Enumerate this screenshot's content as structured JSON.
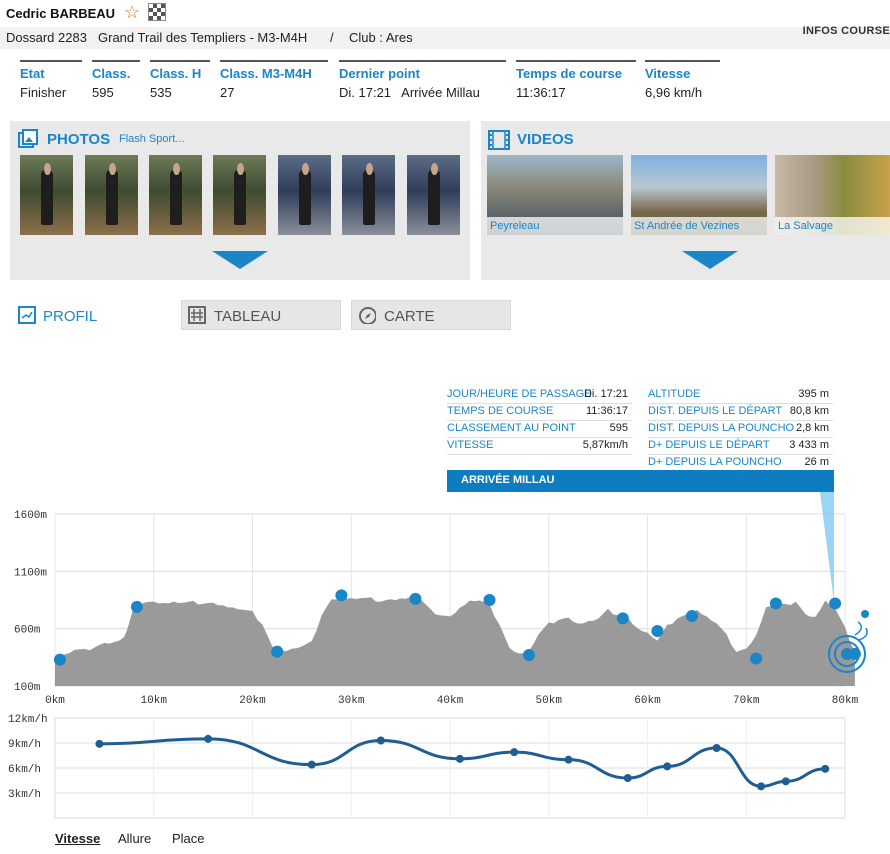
{
  "header": {
    "name": "Cedric BARBEAU",
    "dossard": "Dossard 2283",
    "race": "Grand Trail des Templiers - M3-M4H",
    "separator": "/",
    "club": "Club : Ares",
    "infos_link": "INFOS COURSE"
  },
  "stats": [
    {
      "label": "Etat",
      "value": "Finisher"
    },
    {
      "label": "Class.",
      "value": "595"
    },
    {
      "label": "Class. H",
      "value": "535"
    },
    {
      "label": "Class. M3-M4H",
      "value": "27"
    },
    {
      "label": "Dernier point",
      "value": "Di. 17:21   Arrivée Millau"
    },
    {
      "label": "Temps de course",
      "value": "11:36:17"
    },
    {
      "label": "Vitesse",
      "value": "6,96 km/h"
    }
  ],
  "photos": {
    "title": "PHOTOS",
    "provider": "Flash Sport..."
  },
  "videos": {
    "title": "VIDEOS",
    "items": [
      "Peyreleau",
      "St Andrée de Vezines",
      "La Salvage"
    ]
  },
  "tabs": {
    "profil": "PROFIL",
    "tableau": "TABLEAU",
    "carte": "CARTE"
  },
  "info_left": [
    {
      "k": "JOUR/HEURE DE PASSAGE",
      "v": "Di. 17:21"
    },
    {
      "k": "TEMPS DE COURSE",
      "v": "11:36:17"
    },
    {
      "k": "CLASSEMENT AU POINT",
      "v": "595"
    },
    {
      "k": "VITESSE",
      "v": "5,87km/h"
    }
  ],
  "info_right": [
    {
      "k": "ALTITUDE",
      "v": "395 m"
    },
    {
      "k": "DIST. DEPUIS LE DÉPART",
      "v": "80,8 km"
    },
    {
      "k": "DIST. DEPUIS LA POUNCHO",
      "v": "2,8 km"
    },
    {
      "k": "D+ DEPUIS LE DÉPART",
      "v": "3 433 m"
    },
    {
      "k": "D+ DEPUIS LA POUNCHO",
      "v": "26 m"
    }
  ],
  "point_name": "ARRIVÉE MILLAU",
  "speed_tabs": [
    "Vitesse",
    "Allure",
    "Place"
  ],
  "chart_data": [
    {
      "type": "area",
      "y_tick_labels": [
        "1600m",
        "1100m",
        "600m",
        "100m"
      ],
      "x_tick_labels": [
        "0km",
        "10km",
        "20km",
        "30km",
        "40km",
        "50km",
        "60km",
        "70km",
        "80km"
      ],
      "ylim": [
        100,
        1600
      ],
      "xlim": [
        0,
        80
      ],
      "color": "#9a9a9a",
      "profile_x": [
        0,
        1,
        2,
        3,
        4,
        5,
        6,
        7,
        7.5,
        8,
        9,
        10,
        11,
        12,
        13,
        14,
        15,
        16,
        17,
        18,
        19,
        20,
        21,
        22,
        23,
        24,
        25,
        26,
        27,
        28,
        29,
        30,
        31,
        32,
        33,
        34,
        35,
        36,
        37,
        38,
        39,
        40,
        41,
        42,
        43,
        44,
        45,
        46,
        47,
        48,
        49,
        50,
        51,
        52,
        53,
        54,
        55,
        56,
        57,
        58,
        59,
        60,
        61,
        62,
        63,
        64,
        65,
        66,
        67,
        68,
        69,
        70,
        71,
        72,
        73,
        74,
        75,
        76,
        77,
        78,
        79,
        80,
        81
      ],
      "profile_y": [
        350,
        370,
        420,
        410,
        440,
        470,
        480,
        520,
        650,
        790,
        830,
        830,
        820,
        830,
        830,
        830,
        820,
        820,
        800,
        780,
        770,
        740,
        640,
        440,
        400,
        420,
        450,
        480,
        720,
        850,
        870,
        860,
        870,
        860,
        840,
        850,
        860,
        870,
        860,
        760,
        720,
        700,
        780,
        840,
        850,
        800,
        640,
        430,
        380,
        400,
        560,
        640,
        680,
        690,
        640,
        660,
        690,
        760,
        720,
        690,
        600,
        560,
        500,
        620,
        690,
        720,
        760,
        700,
        650,
        540,
        400,
        420,
        540,
        780,
        830,
        800,
        840,
        720,
        700,
        840,
        780,
        600,
        400
      ],
      "checkpoints_x": [
        0.5,
        8.3,
        22.5,
        29,
        36.5,
        44,
        48,
        57.5,
        61,
        64.5,
        71,
        73,
        79,
        81
      ],
      "checkpoints_y": [
        330,
        790,
        400,
        890,
        860,
        850,
        370,
        690,
        580,
        710,
        340,
        820,
        820,
        380
      ]
    },
    {
      "type": "line",
      "y_tick_labels": [
        "12km/h",
        "9km/h",
        "6km/h",
        "3km/h"
      ],
      "ylim": [
        0,
        12
      ],
      "color": "#1f5e94",
      "x": [
        4.5,
        15.5,
        26,
        33,
        41,
        46.5,
        52,
        58,
        62,
        67,
        71.5,
        74,
        78
      ],
      "values": [
        8.9,
        9.5,
        6.4,
        9.3,
        7.1,
        7.9,
        7.0,
        4.8,
        6.2,
        8.4,
        3.8,
        4.4,
        5.9
      ]
    }
  ]
}
